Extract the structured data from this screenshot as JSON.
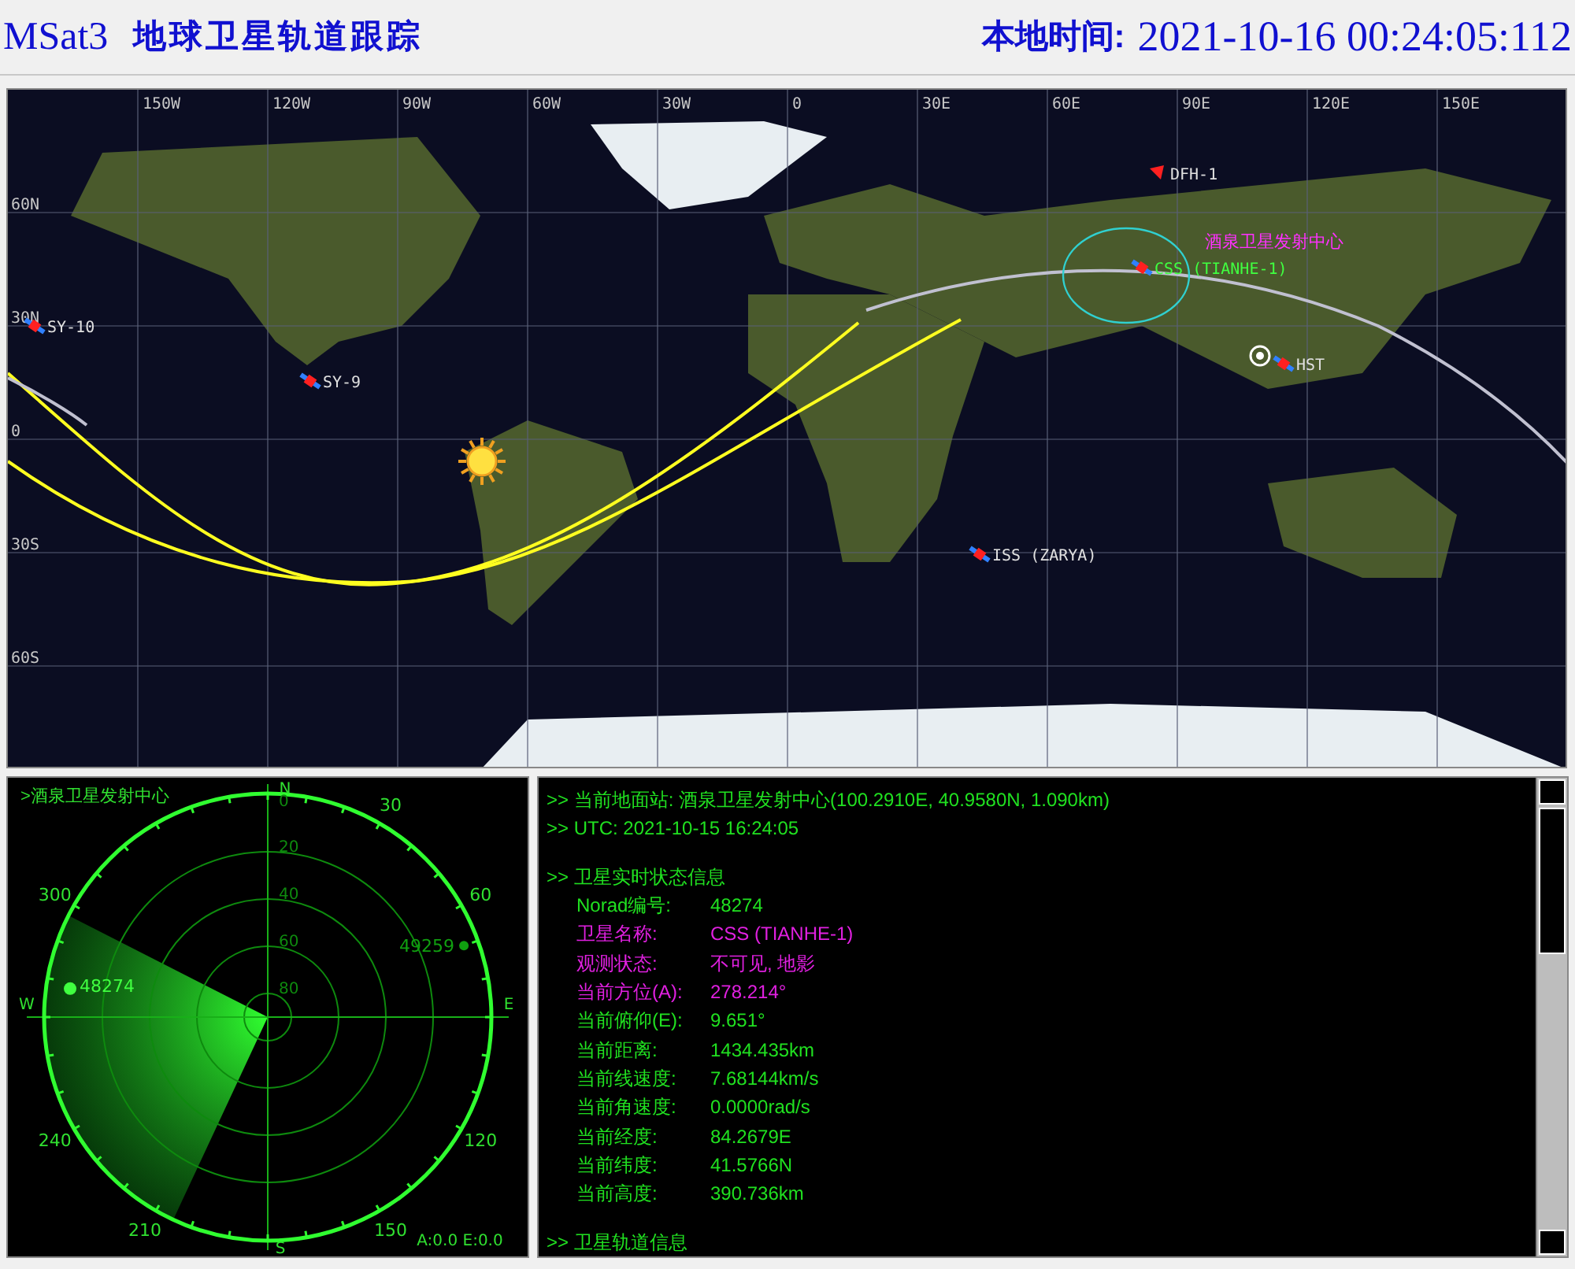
{
  "header": {
    "app_name": "MSat3",
    "title": "地球卫星轨道跟踪",
    "time_label": "本地时间:",
    "local_time": "2021-10-16 00:24:05:112"
  },
  "map": {
    "lon_labels": [
      "150W",
      "120W",
      "90W",
      "60W",
      "30W",
      "0",
      "30E",
      "60E",
      "90E",
      "120E",
      "150E"
    ],
    "lat_labels": [
      "60N",
      "30N",
      "0",
      "30S",
      "60S"
    ],
    "satellites": [
      {
        "label": "DFH-1",
        "kind": "marker"
      },
      {
        "label": "CSS (TIANHE-1)",
        "kind": "tracked"
      },
      {
        "label": "SY-10",
        "kind": "satellite"
      },
      {
        "label": "SY-9",
        "kind": "satellite"
      },
      {
        "label": "HST",
        "kind": "satellite"
      },
      {
        "label": "ISS (ZARYA)",
        "kind": "satellite"
      }
    ],
    "station": {
      "label": "酒泉卫星发射中心"
    }
  },
  "radar": {
    "title": ">酒泉卫星发射中心",
    "compass": [
      "N",
      "E",
      "S",
      "W"
    ],
    "azimuth_labels": [
      "30",
      "60",
      "120",
      "150",
      "210",
      "240",
      "300"
    ],
    "ring_labels": [
      "0",
      "20",
      "40",
      "60",
      "80"
    ],
    "targets": [
      {
        "label": "48274",
        "selected": true
      },
      {
        "label": "49259",
        "selected": false
      }
    ],
    "readout": "A:0.0 E:0.0"
  },
  "info": {
    "lines": [
      {
        "kind": "header",
        "text": ">> 当前地面站: 酒泉卫星发射中心(100.2910E, 40.9580N, 1.090km)"
      },
      {
        "kind": "header",
        "text": ">> UTC: 2021-10-15 16:24:05"
      },
      {
        "kind": "blank"
      },
      {
        "kind": "header",
        "text": ">> 卫星实时状态信息"
      },
      {
        "kind": "field",
        "label": "Norad编号:",
        "value": "48274",
        "highlighted": false
      },
      {
        "kind": "field",
        "label": "卫星名称:",
        "value": "CSS (TIANHE-1)",
        "highlighted": true
      },
      {
        "kind": "field",
        "label": "观测状态:",
        "value": "不可见, 地影",
        "highlighted": true
      },
      {
        "kind": "field",
        "label": "当前方位(A):",
        "value": "278.214°",
        "highlighted": true
      },
      {
        "kind": "field",
        "label": "当前俯仰(E):",
        "value": "9.651°",
        "highlighted": false
      },
      {
        "kind": "field",
        "label": "当前距离:",
        "value": "1434.435km",
        "highlighted": false
      },
      {
        "kind": "field",
        "label": "当前线速度:",
        "value": "7.68144km/s",
        "highlighted": false
      },
      {
        "kind": "field",
        "label": "当前角速度:",
        "value": "0.0000rad/s",
        "highlighted": false
      },
      {
        "kind": "field",
        "label": "当前经度:",
        "value": "84.2679E",
        "highlighted": false
      },
      {
        "kind": "field",
        "label": "当前纬度:",
        "value": "41.5766N",
        "highlighted": false
      },
      {
        "kind": "field",
        "label": "当前高度:",
        "value": "390.736km",
        "highlighted": false
      },
      {
        "kind": "blank"
      },
      {
        "kind": "header",
        "text": ">> 卫星轨道信息"
      }
    ]
  }
}
